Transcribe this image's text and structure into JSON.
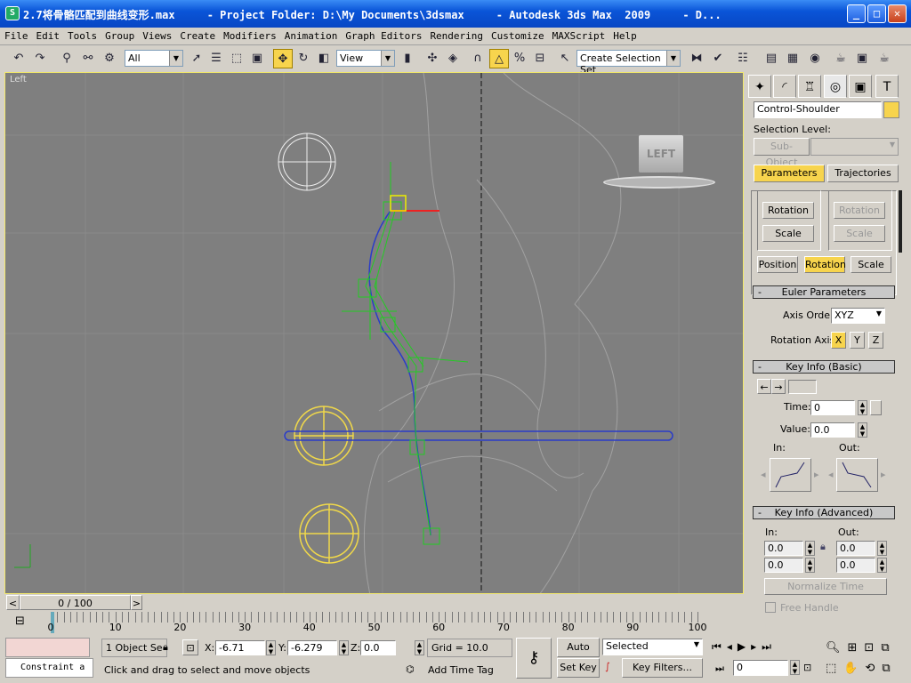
{
  "window": {
    "title": "2.7将骨骼匹配到曲线变形.max     - Project Folder: D:\\My Documents\\3dsmax     - Autodesk 3ds Max  2009     - D...",
    "min": "_",
    "max": "□",
    "close": "✕"
  },
  "menu": [
    "File",
    "Edit",
    "Tools",
    "Group",
    "Views",
    "Create",
    "Modifiers",
    "Animation",
    "Graph Editors",
    "Rendering",
    "Customize",
    "MAXScript",
    "Help"
  ],
  "toolbar": {
    "filter": "All",
    "ref_coord": "View",
    "selection_set": "Create Selection Set"
  },
  "viewport": {
    "label": "Left",
    "viewcube": "LEFT",
    "accent": "#f2e86a"
  },
  "panel": {
    "object_name": "Control-Shoulder",
    "object_color": "#f7d44d",
    "selection_level": "Selection Level:",
    "sub_object": "Sub-Object",
    "tabs": [
      "Parameters",
      "Trajectories"
    ],
    "left_buttons": [
      "Rotation",
      "Scale"
    ],
    "right_buttons": [
      "Rotation",
      "Scale"
    ],
    "prs": [
      "Position",
      "Rotation",
      "Scale"
    ],
    "euler": {
      "title": "Euler Parameters",
      "axis_order_label": "Axis Order:",
      "axis_order": "XYZ",
      "rotation_axis_label": "Rotation Axis:",
      "axes": [
        "X",
        "Y",
        "Z"
      ]
    },
    "key_basic": {
      "title": "Key Info (Basic)",
      "time_label": "Time:",
      "time": "0",
      "value_label": "Value:",
      "value": "0.0",
      "in": "In:",
      "out": "Out:"
    },
    "key_adv": {
      "title": "Key Info (Advanced)",
      "in": "In:",
      "out": "Out:",
      "in1": "0.0",
      "in2": "0.0",
      "out1": "0.0",
      "out2": "0.0",
      "normalize": "Normalize Time",
      "free_handle": "Free Handle"
    }
  },
  "timeline": {
    "position": "0 / 100",
    "prev": "<",
    "next": ">",
    "ticks": [
      "0",
      "10",
      "20",
      "30",
      "40",
      "50",
      "60",
      "70",
      "80",
      "90",
      "100"
    ]
  },
  "status": {
    "constraint": "Constraint a",
    "selected": "1 Object Se",
    "x_label": "X:",
    "x": "-6.71",
    "y_label": "Y:",
    "y": "-6.279",
    "z_label": "Z:",
    "z": "0.0",
    "grid": "Grid = 10.0",
    "prompt": "Click and drag to select and move objects",
    "add_time_tag": "Add Time Tag",
    "auto_key": "Auto Key",
    "set_key": "Set Key",
    "key_mode": "Selected",
    "key_filters": "Key Filters...",
    "frame": "0"
  }
}
